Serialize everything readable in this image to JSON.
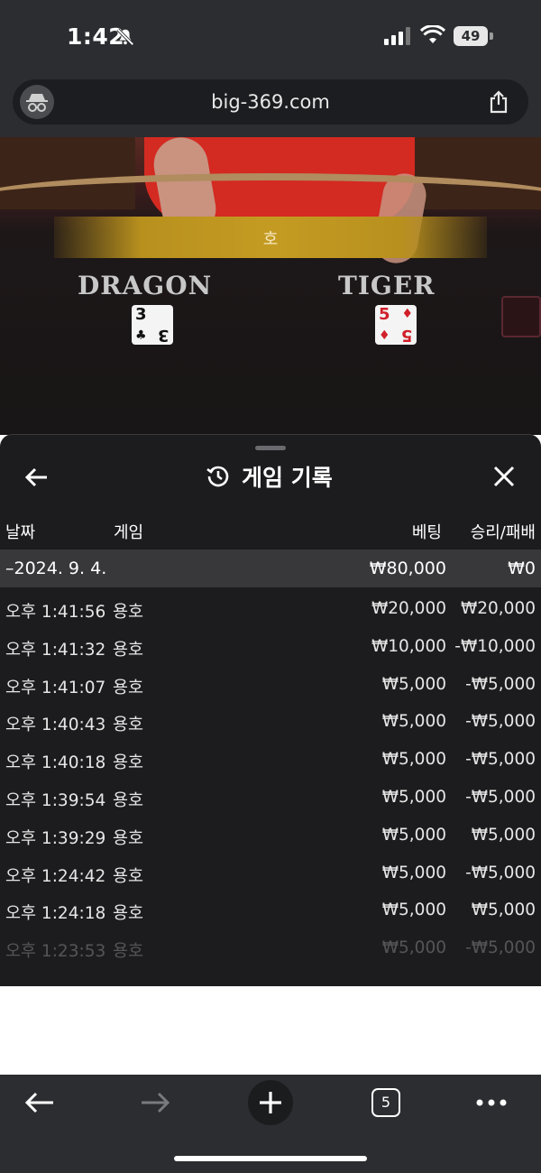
{
  "status_bar": {
    "time": "1:42",
    "battery": "49"
  },
  "browser": {
    "url": "big-369.com",
    "tab_count": "5"
  },
  "game": {
    "result_label": "호",
    "left_label": "DRAGON",
    "right_label": "TIGER",
    "dragon_card": {
      "rank": "3",
      "suit": "♣"
    },
    "tiger_card": {
      "rank": "5",
      "suit": "♦"
    }
  },
  "sheet": {
    "title": "게임 기록",
    "columns": {
      "date": "날짜",
      "game": "게임",
      "bet": "베팅",
      "result": "승리/패배"
    },
    "group": {
      "date": "–2024. 9. 4.",
      "bet": "₩80,000",
      "result": "₩0"
    },
    "rows": [
      {
        "time": "오후 1:41:56",
        "game": "용호",
        "bet": "₩20,000",
        "result": "₩20,000"
      },
      {
        "time": "오후 1:41:32",
        "game": "용호",
        "bet": "₩10,000",
        "result": "-₩10,000"
      },
      {
        "time": "오후 1:41:07",
        "game": "용호",
        "bet": "₩5,000",
        "result": "-₩5,000"
      },
      {
        "time": "오후 1:40:43",
        "game": "용호",
        "bet": "₩5,000",
        "result": "-₩5,000"
      },
      {
        "time": "오후 1:40:18",
        "game": "용호",
        "bet": "₩5,000",
        "result": "-₩5,000"
      },
      {
        "time": "오후 1:39:54",
        "game": "용호",
        "bet": "₩5,000",
        "result": "-₩5,000"
      },
      {
        "time": "오후 1:39:29",
        "game": "용호",
        "bet": "₩5,000",
        "result": "₩5,000"
      },
      {
        "time": "오후 1:24:42",
        "game": "용호",
        "bet": "₩5,000",
        "result": "-₩5,000"
      },
      {
        "time": "오후 1:24:18",
        "game": "용호",
        "bet": "₩5,000",
        "result": "₩5,000"
      },
      {
        "time": "오후 1:23:53",
        "game": "용호",
        "bet": "₩5,000",
        "result": "-₩5,000"
      }
    ]
  },
  "icons": {
    "bell": "bell-slash-icon",
    "signal": "signal-icon",
    "wifi": "wifi-icon",
    "incognito": "incognito-icon",
    "share": "share-icon",
    "history": "history-icon",
    "back": "arrow-left-icon",
    "close": "close-icon",
    "forward": "arrow-right-icon",
    "new_tab": "plus-icon",
    "more": "more-icon"
  },
  "colors": {
    "sheet_bg": "#1c1c1e",
    "group_row_bg": "#38383a",
    "gold": "#c49b22",
    "chrome_bg": "#2b2d30"
  }
}
